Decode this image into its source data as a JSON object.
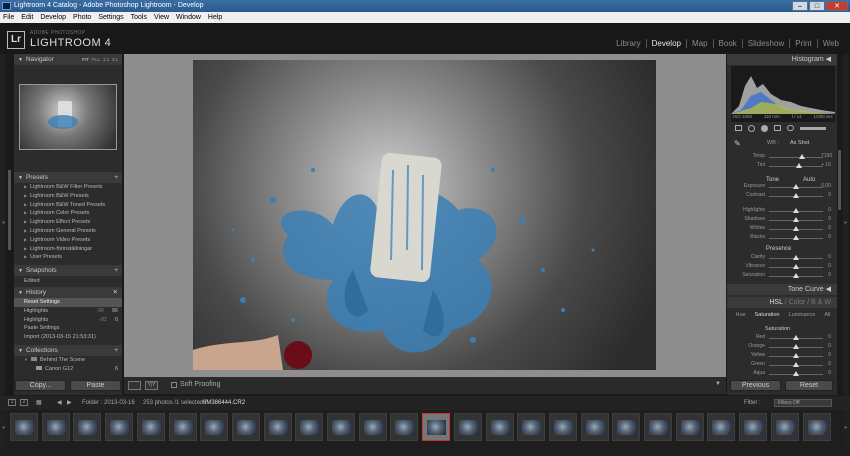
{
  "window": {
    "title": "Lightroom 4 Catalog - Adobe Photoshop Lightroom - Develop"
  },
  "menu": [
    "File",
    "Edit",
    "Develop",
    "Photo",
    "Settings",
    "Tools",
    "View",
    "Window",
    "Help"
  ],
  "brand": {
    "badge": "Lr",
    "small": "ADOBE PHOTOSHOP",
    "big": "LIGHTROOM 4"
  },
  "modules": [
    "Library",
    "Develop",
    "Map",
    "Book",
    "Slideshow",
    "Print",
    "Web"
  ],
  "left": {
    "navigator": {
      "title": "Navigator",
      "zoom": [
        "FIT",
        "FILL",
        "1:1",
        "3:1"
      ]
    },
    "presets": {
      "title": "Presets",
      "items": [
        "Lightroom B&W Filter Presets",
        "Lightroom B&W Presets",
        "Lightroom B&W Toned Presets",
        "Lightroom Color Presets",
        "Lightroom Effect Presets",
        "Lightroom General Presets",
        "Lightroom Video Presets",
        "Lightroom-förinställningar",
        "User Presets"
      ]
    },
    "snapshots": {
      "title": "Snapshots",
      "items": [
        "Edited"
      ]
    },
    "history": {
      "title": "History",
      "items": [
        {
          "label": "Reset Settings",
          "a": "",
          "b": ""
        },
        {
          "label": "Highlights",
          "a": "-98",
          "b": "96"
        },
        {
          "label": "Highlights",
          "a": "-82",
          "b": "0"
        },
        {
          "label": "Paste Settings",
          "a": "",
          "b": ""
        },
        {
          "label": "Import (2013-03-15 21:53:31)",
          "a": "",
          "b": ""
        }
      ]
    },
    "collections": {
      "title": "Collections",
      "items": [
        {
          "label": "Behind The Scene",
          "count": ""
        },
        {
          "label": "Canon G12",
          "count": "6"
        }
      ]
    },
    "copy": "Copy...",
    "paste": "Paste"
  },
  "toolbar": {
    "soft_proofing": "Soft Proofing"
  },
  "right": {
    "histogram": {
      "title": "Histogram",
      "iso": "ISO 1000",
      "focal": "110 mm",
      "aperture": "f / 14",
      "shutter": "1/200 sec"
    },
    "wb": {
      "label": "WB :",
      "value": "As Shot"
    },
    "temp_tint": [
      {
        "label": "Temp",
        "value": "7150",
        "pos": 0.62
      },
      {
        "label": "Tint",
        "value": "+ 16",
        "pos": 0.55
      }
    ],
    "tone": {
      "label": "Tone",
      "auto": "Auto"
    },
    "tone_sliders": [
      {
        "label": "Exposure",
        "value": "0,00",
        "pos": 0.5
      },
      {
        "label": "Contrast",
        "value": "0",
        "pos": 0.5
      },
      {
        "label": "Highlights",
        "value": "0",
        "pos": 0.5
      },
      {
        "label": "Shadows",
        "value": "0",
        "pos": 0.5
      },
      {
        "label": "Whites",
        "value": "0",
        "pos": 0.5
      },
      {
        "label": "Blacks",
        "value": "0",
        "pos": 0.5
      }
    ],
    "presence": {
      "label": "Presence"
    },
    "presence_sliders": [
      {
        "label": "Clarity",
        "value": "0",
        "pos": 0.5
      },
      {
        "label": "Vibrance",
        "value": "0",
        "pos": 0.5
      },
      {
        "label": "Saturation",
        "value": "0",
        "pos": 0.5
      }
    ],
    "tone_curve": "Tone Curve",
    "hsl_tabs": [
      "HSL",
      "/",
      "Color",
      "/",
      "B & W"
    ],
    "hsl_sub": [
      "Hue",
      "Saturation",
      "Luminance",
      "All"
    ],
    "saturation_label": "Saturation",
    "color_sliders": [
      {
        "label": "Red",
        "value": "0",
        "pos": 0.5
      },
      {
        "label": "Orange",
        "value": "0",
        "pos": 0.5
      },
      {
        "label": "Yellow",
        "value": "0",
        "pos": 0.5
      },
      {
        "label": "Green",
        "value": "0",
        "pos": 0.5
      },
      {
        "label": "Aqua",
        "value": "0",
        "pos": 0.5
      }
    ],
    "previous": "Previous",
    "reset": "Reset"
  },
  "filmstrip": {
    "page1": "1",
    "page2": "2",
    "folder": "Folder : 2013-03-16",
    "count": "253 photos /1 selected /",
    "filename": "6M386444.CR2",
    "filter_label": "Filter :",
    "filter_value": "Filters Off",
    "thumb_count": 26,
    "selected_index": 13
  },
  "colors": {
    "accent": "#c43c2c",
    "panel": "#2c2c2c",
    "center": "#8e8e8e",
    "paint_blue": "#3a7fb5"
  }
}
